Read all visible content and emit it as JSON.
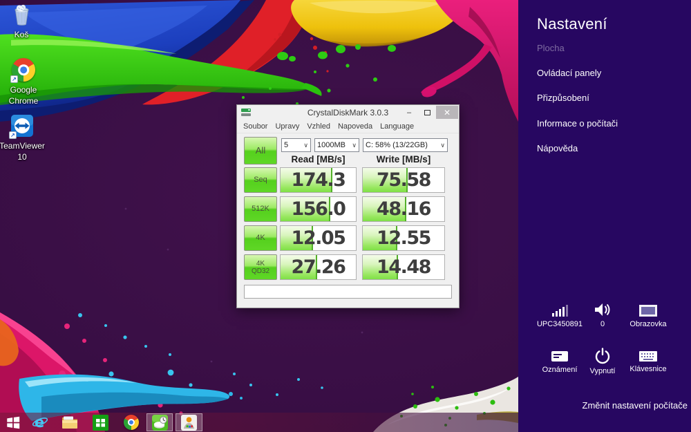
{
  "desktop_icons": [
    {
      "label": "Koš"
    },
    {
      "label": "Google Chrome"
    },
    {
      "label": "TeamViewer 10"
    }
  ],
  "window": {
    "title": "CrystalDiskMark 3.0.3",
    "menu": [
      "Soubor",
      "Upravy",
      "Vzhled",
      "Napoveda",
      "Language"
    ],
    "controls": {
      "minimize": "–",
      "close": "✕"
    },
    "chevron": "∨",
    "all_button": "All",
    "test_count": "5",
    "test_size": "1000MB",
    "drive": "C: 58% (13/22GB)",
    "read_header": "Read [MB/s]",
    "write_header": "Write [MB/s]",
    "rows": [
      {
        "label": "Seq",
        "read": "174.3",
        "write": "75.58",
        "read_fill": 69,
        "write_fill": 55
      },
      {
        "label": "512K",
        "read": "156.0",
        "write": "48.16",
        "read_fill": 66,
        "write_fill": 53
      },
      {
        "label": "4K",
        "read": "12.05",
        "write": "12.55",
        "read_fill": 43,
        "write_fill": 42
      },
      {
        "label": "4K QD32",
        "read": "27.26",
        "write": "14.48",
        "read_fill": 49,
        "write_fill": 43
      }
    ],
    "comment_value": ""
  },
  "charms": {
    "bg": "#270761",
    "title": "Nastavení",
    "items": [
      {
        "label": "Plocha",
        "dimmed": true
      },
      {
        "label": "Ovládací panely",
        "dimmed": false
      },
      {
        "label": "Přizpůsobení",
        "dimmed": false
      },
      {
        "label": "Informace o počítači",
        "dimmed": false
      },
      {
        "label": "Nápověda",
        "dimmed": false
      }
    ],
    "tiles": [
      {
        "icon": "network-signal",
        "label": "UPC3450891"
      },
      {
        "icon": "volume",
        "label": "0"
      },
      {
        "icon": "screen",
        "label": "Obrazovka"
      },
      {
        "icon": "notifications",
        "label": "Oznámení"
      },
      {
        "icon": "power",
        "label": "Vypnutí"
      },
      {
        "icon": "keyboard",
        "label": "Klávesnice"
      }
    ],
    "footer_link": "Změnit nastavení počítače"
  },
  "taskbar": {
    "items": [
      "start",
      "internet-explorer",
      "file-explorer",
      "windows-store",
      "google-chrome",
      "crystaldiskmark",
      "image-viewer"
    ],
    "running": [
      "crystaldiskmark",
      "image-viewer"
    ]
  }
}
